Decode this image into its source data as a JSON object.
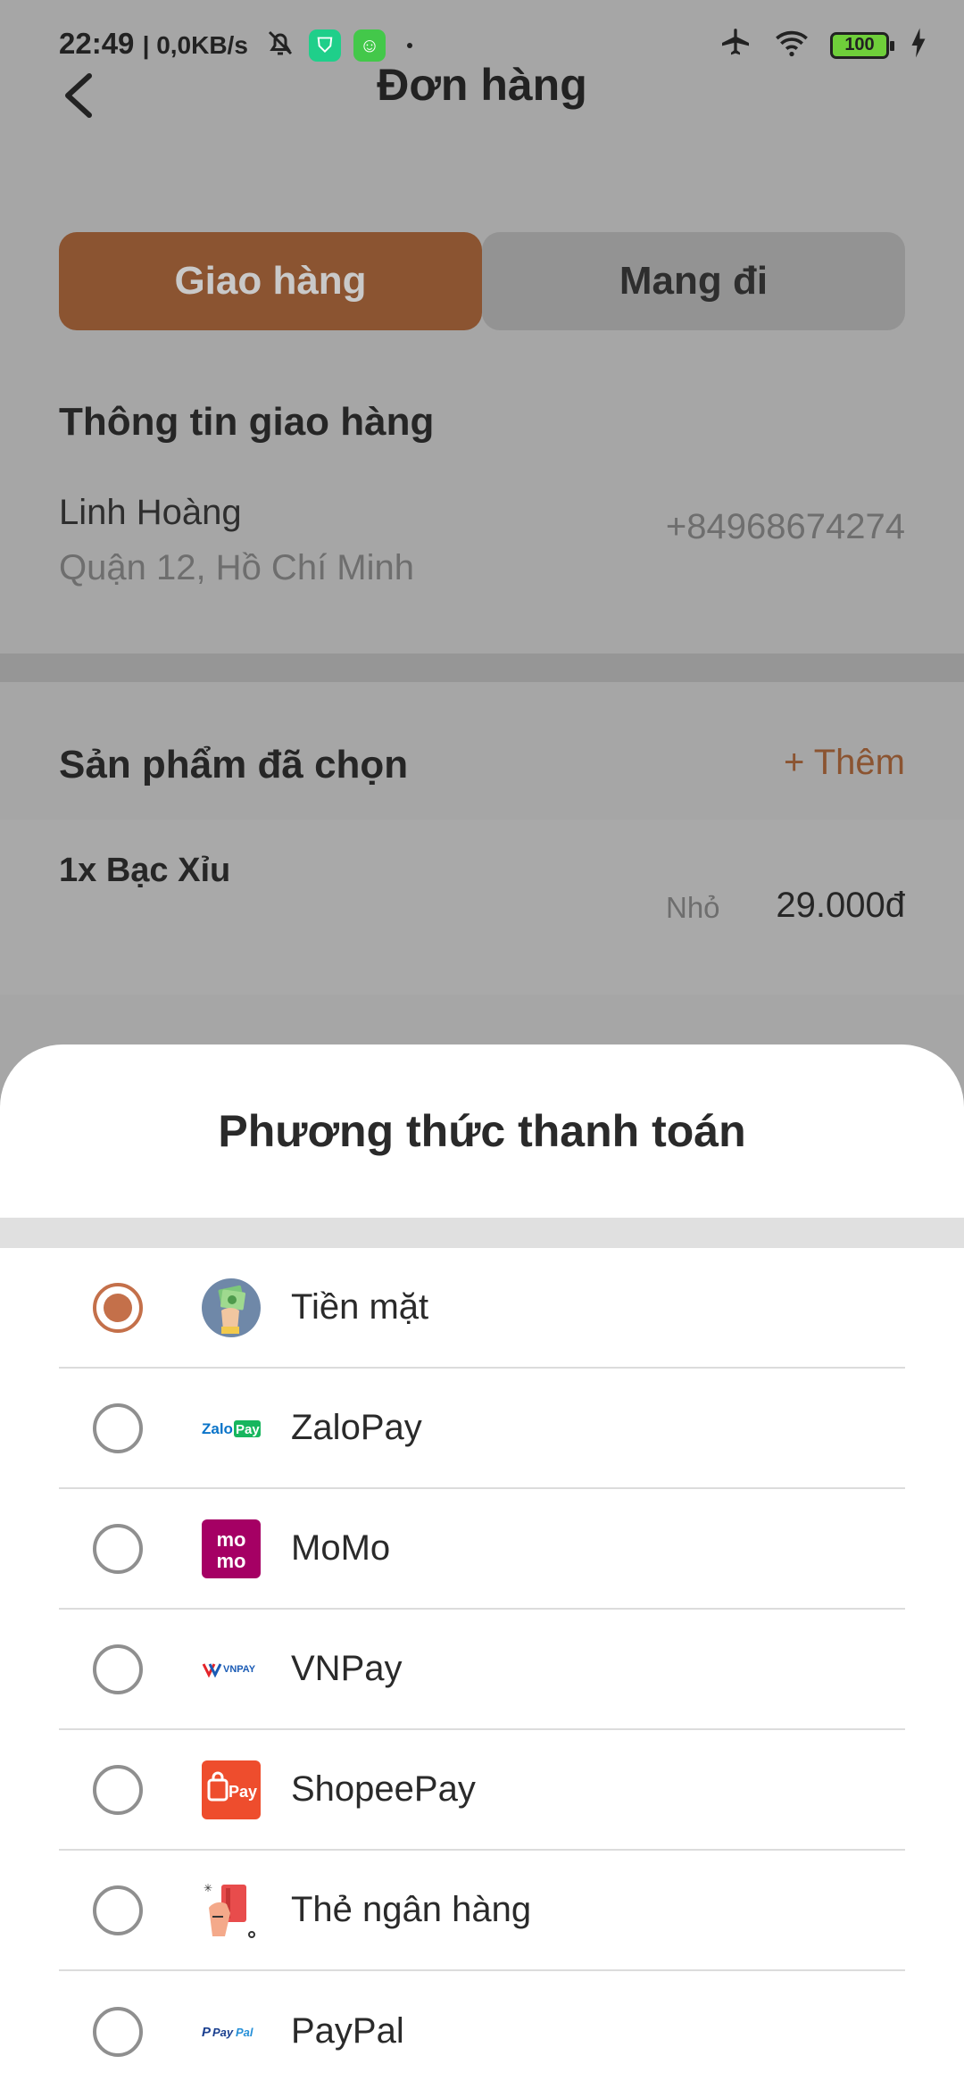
{
  "status": {
    "time": "22:49",
    "speed": "| 0,0KB/s",
    "battery": "100"
  },
  "header": {
    "title": "Đơn hàng"
  },
  "tabs": [
    {
      "label": "Giao hàng",
      "active": true
    },
    {
      "label": "Mang đi",
      "active": false
    }
  ],
  "shipping": {
    "section_title": "Thông tin giao hàng",
    "name": "Linh Hoàng",
    "address": "Quận 12, Hồ Chí Minh",
    "phone": "+84968674274"
  },
  "products": {
    "section_title": "Sản phẩm đã chọn",
    "add_label": "+ Thêm",
    "items": [
      {
        "name": "1x Bạc Xỉu",
        "size": "Nhỏ",
        "price": "29.000đ"
      }
    ]
  },
  "payment_sheet": {
    "title": "Phương thức thanh toán",
    "methods": [
      {
        "label": "Tiền mặt",
        "icon": "cash-icon",
        "selected": true
      },
      {
        "label": "ZaloPay",
        "icon": "zalopay-logo-icon",
        "selected": false
      },
      {
        "label": "MoMo",
        "icon": "momo-logo-icon",
        "selected": false
      },
      {
        "label": "VNPay",
        "icon": "vnpay-logo-icon",
        "selected": false
      },
      {
        "label": "ShopeePay",
        "icon": "shopeepay-logo-icon",
        "selected": false
      },
      {
        "label": "Thẻ ngân hàng",
        "icon": "bank-card-icon",
        "selected": false
      },
      {
        "label": "PayPal",
        "icon": "paypal-logo-icon",
        "selected": false
      }
    ]
  },
  "colors": {
    "accent": "#c4704a",
    "accent_dim": "#8b5431",
    "overlay_bg": "#a6a6a6"
  }
}
